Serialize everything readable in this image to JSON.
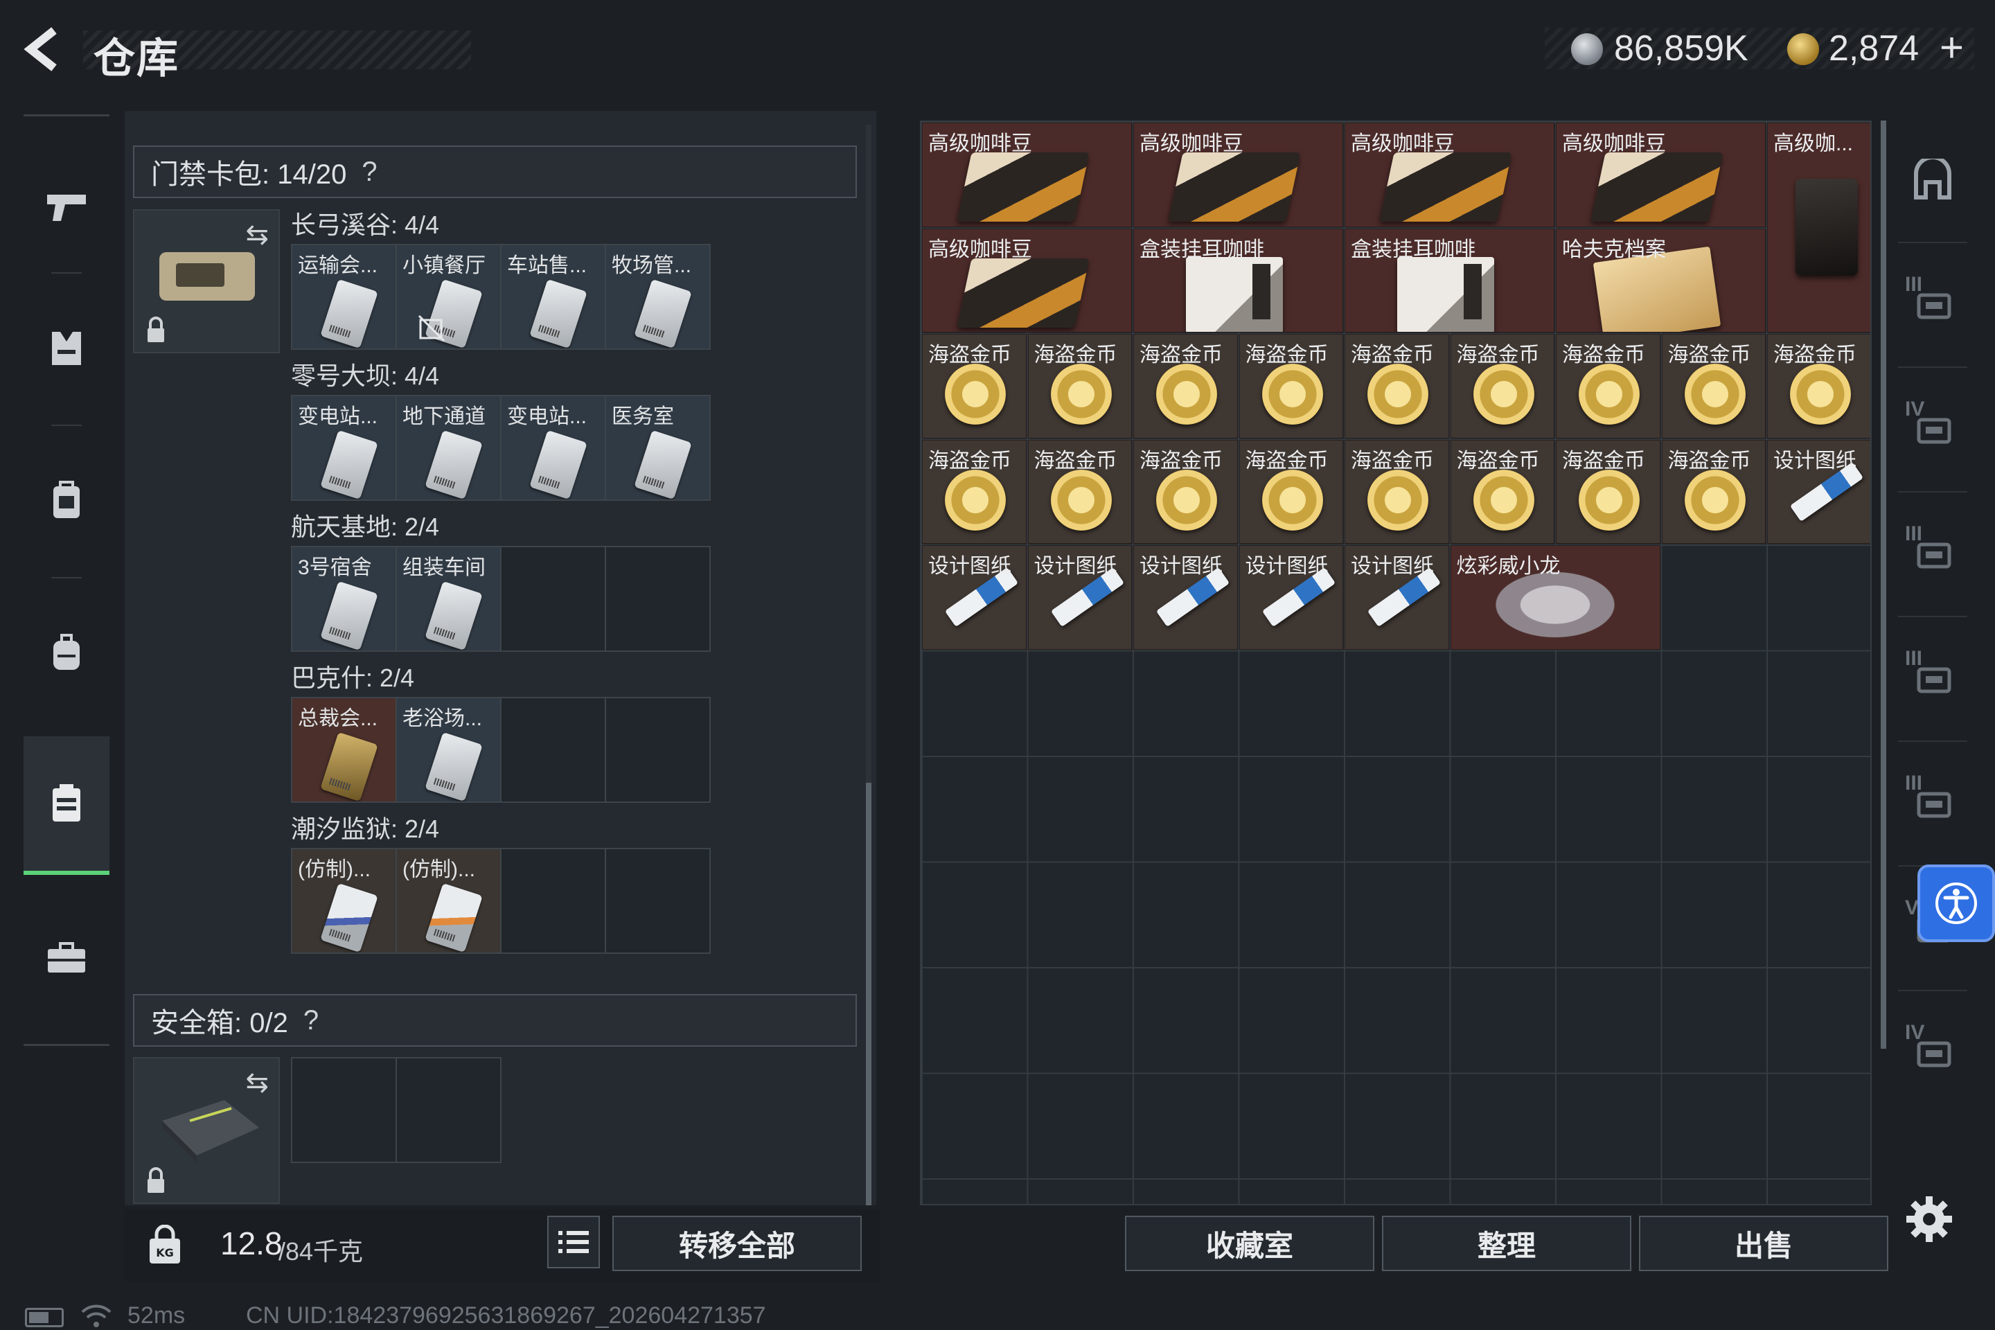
{
  "header": {
    "title": "仓库",
    "silver_amount": "86,859K",
    "gold_amount": "2,874",
    "gold_add": "+"
  },
  "left_nav": {
    "items": [
      "pistol-icon",
      "armor-icon",
      "backpack-icon",
      "chest-rig-icon",
      "keycard-wallet-icon",
      "briefcase-icon"
    ],
    "active": "keycard-wallet-icon"
  },
  "keycard_wallet": {
    "header": "门禁卡包: 14/20",
    "help": "?",
    "categories": [
      {
        "label": "长弓溪谷: 4/4",
        "slots": [
          "运输会...",
          "小镇餐厅",
          "车站售...",
          "牧场管..."
        ]
      },
      {
        "label": "零号大坝: 4/4",
        "slots": [
          "变电站...",
          "地下通道",
          "变电站...",
          "医务室"
        ]
      },
      {
        "label": "航天基地: 2/4",
        "slots": [
          "3号宿舍",
          "组装车间"
        ]
      },
      {
        "label": "巴克什: 2/4",
        "slots": [
          "总裁会...",
          "老浴场..."
        ]
      },
      {
        "label": "潮汐监狱: 2/4",
        "slots": [
          "(仿制)...",
          "(仿制)..."
        ]
      }
    ]
  },
  "safe_box": {
    "header": "安全箱: 0/2",
    "help": "?"
  },
  "weight": {
    "current": "12.8",
    "rest": "/84千克"
  },
  "buttons": {
    "transfer_all": "转移全部",
    "collection": "收藏室",
    "organize": "整理",
    "sell": "出售"
  },
  "storage": {
    "items": [
      {
        "name": "高级咖啡豆",
        "kind": "coffee"
      },
      {
        "name": "高级咖啡豆",
        "kind": "coffee"
      },
      {
        "name": "高级咖啡豆",
        "kind": "coffee"
      },
      {
        "name": "高级咖啡豆",
        "kind": "coffee"
      },
      {
        "name": "高级咖...",
        "kind": "coffee-tall"
      },
      {
        "name": "高级咖啡豆",
        "kind": "coffee"
      },
      {
        "name": "盒装挂耳咖啡",
        "kind": "coffee-box"
      },
      {
        "name": "盒装挂耳咖啡",
        "kind": "coffee-box"
      },
      {
        "name": "哈夫克档案",
        "kind": "dossier"
      },
      {
        "name": "海盗金币",
        "kind": "coin"
      },
      {
        "name": "海盗金币",
        "kind": "coin"
      },
      {
        "name": "海盗金币",
        "kind": "coin"
      },
      {
        "name": "海盗金币",
        "kind": "coin"
      },
      {
        "name": "海盗金币",
        "kind": "coin"
      },
      {
        "name": "海盗金币",
        "kind": "coin"
      },
      {
        "name": "海盗金币",
        "kind": "coin"
      },
      {
        "name": "海盗金币",
        "kind": "coin"
      },
      {
        "name": "海盗金币",
        "kind": "coin"
      },
      {
        "name": "海盗金币",
        "kind": "coin"
      },
      {
        "name": "海盗金币",
        "kind": "coin"
      },
      {
        "name": "海盗金币",
        "kind": "coin"
      },
      {
        "name": "海盗金币",
        "kind": "coin"
      },
      {
        "name": "海盗金币",
        "kind": "coin"
      },
      {
        "name": "海盗金币",
        "kind": "coin"
      },
      {
        "name": "海盗金币",
        "kind": "coin"
      },
      {
        "name": "海盗金币",
        "kind": "coin"
      },
      {
        "name": "设计图纸",
        "kind": "blueprint"
      },
      {
        "name": "设计图纸",
        "kind": "blueprint"
      },
      {
        "name": "设计图纸",
        "kind": "blueprint"
      },
      {
        "name": "设计图纸",
        "kind": "blueprint"
      },
      {
        "name": "设计图纸",
        "kind": "blueprint"
      },
      {
        "name": "设计图纸",
        "kind": "blueprint"
      },
      {
        "name": "炫彩威小龙",
        "kind": "dragon"
      }
    ]
  },
  "right_filters": {
    "tiers": [
      "",
      "III",
      "IV",
      "III",
      "III",
      "III",
      "V",
      "IV"
    ]
  },
  "status": {
    "ping": "52ms",
    "uid": "CN UID:1842379692563186​9267_202604271357"
  },
  "colors": {
    "active_accent": "#5bd27a",
    "rare_item_bg": "#4b2b29",
    "common_item_bg": "#3f3732",
    "a11y_button": "#2f6fe4"
  }
}
